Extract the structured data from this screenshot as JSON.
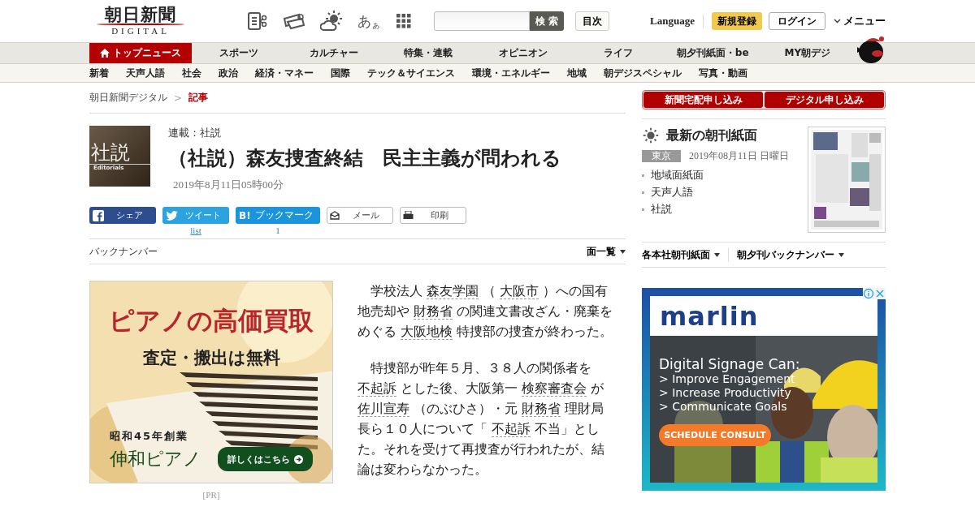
{
  "header": {
    "logo_title": "朝日新聞",
    "logo_sub": "DIGITAL",
    "font_size_large": "あ",
    "font_size_small": "ぁ",
    "search_button": "検 索",
    "index_button": "目次",
    "language": "Language",
    "signup": "新規登録",
    "login": "ログイン",
    "menu": "メニュー"
  },
  "nav_primary": [
    {
      "label": "トップニュース",
      "selected": true
    },
    {
      "label": "スポーツ",
      "selected": false
    },
    {
      "label": "カルチャー",
      "selected": false
    },
    {
      "label": "特集・連載",
      "selected": false
    },
    {
      "label": "オピニオン",
      "selected": false
    },
    {
      "label": "ライフ",
      "selected": false
    },
    {
      "label": "朝夕刊紙面・be",
      "selected": false
    },
    {
      "label": "MY朝デジ",
      "selected": false
    }
  ],
  "nav_secondary": [
    "新着",
    "天声人語",
    "社会",
    "政治",
    "経済・マネー",
    "国際",
    "テック＆サイエンス",
    "環境・エネルギー",
    "地域",
    "朝デジスペシャル",
    "写真・動画"
  ],
  "breadcrumb": {
    "separator": ">",
    "items": [
      {
        "label": "朝日新聞デジタル",
        "current": false
      },
      {
        "label": "記事",
        "current": true
      }
    ]
  },
  "article": {
    "thumbnail": {
      "title": "社説",
      "sub": "Editorials"
    },
    "series": "連載：社説",
    "title": "（社説）森友捜査終結　民主主義が問われる",
    "date": "2019年8月11日05時00分",
    "share": [
      {
        "kind": "facebook",
        "label": "シェア"
      },
      {
        "kind": "twitter",
        "label": "ツイート",
        "count": "list"
      },
      {
        "kind": "hatena",
        "badge": "B!",
        "label": "ブックマーク",
        "count": "1"
      },
      {
        "kind": "mail",
        "label": "メール"
      },
      {
        "kind": "print",
        "label": "印刷"
      }
    ],
    "backnumber": "バックナンバー",
    "page_list": "面一覧",
    "paragraphs": [
      [
        {
          "kind": "text",
          "text": "学校法人 "
        },
        {
          "kind": "term",
          "text": "森友学園"
        },
        {
          "kind": "text",
          "text": " （ "
        },
        {
          "kind": "term",
          "text": "大阪市"
        },
        {
          "kind": "text",
          "text": " ）への国有地売却や "
        },
        {
          "kind": "term",
          "text": "財務省"
        },
        {
          "kind": "text",
          "text": " の関連文書改ざん・廃棄をめぐる "
        },
        {
          "kind": "term",
          "text": "大阪地検"
        },
        {
          "kind": "text",
          "text": " 特捜部の捜査が終わった。"
        }
      ],
      [
        {
          "kind": "text",
          "text": "特捜部が昨年５月、３８人の関係者を "
        },
        {
          "kind": "term",
          "text": "不起訴"
        },
        {
          "kind": "text",
          "text": " とした後、大阪第一 "
        },
        {
          "kind": "term",
          "text": "検察審査会"
        },
        {
          "kind": "text",
          "text": " が "
        },
        {
          "kind": "term",
          "text": "佐川宣寿"
        },
        {
          "kind": "text",
          "text": " （のぶひさ）・元 "
        },
        {
          "kind": "term",
          "text": "財務省"
        },
        {
          "kind": "text",
          "text": " 理財局長ら１０人について「 "
        },
        {
          "kind": "term",
          "text": "不起訴"
        },
        {
          "kind": "text",
          "text": " 不当」とした。それを受けて再捜査が行われたが、結論は変わらなかった。"
        }
      ]
    ]
  },
  "ad_left": {
    "headline": "ピアノの高価買取",
    "subhead": "査定・搬出は無料",
    "founded": "昭和45年創業",
    "brand": "伸和ピアノ",
    "cta": "詳しくはこちら",
    "note": "[PR]"
  },
  "sidebar": {
    "subscribe": [
      "新聞宅配申し込み",
      "デジタル申し込み"
    ],
    "paper_title": "最新の朝刊紙面",
    "region": "東京",
    "paper_date": "2019年08月11日 日曜日",
    "links": [
      "地域面紙面",
      "天声人語",
      "社説"
    ],
    "menus": [
      "各本社朝刊紙面",
      "朝夕刊バックナンバー"
    ]
  },
  "ad_right": {
    "brand": "marlin",
    "headline": "Digital Signage Can:",
    "bullets": [
      "> Improve Engagement",
      "> Increase Productivity",
      "> Communicate Goals"
    ],
    "cta": "SCHEDULE CONSULT"
  }
}
